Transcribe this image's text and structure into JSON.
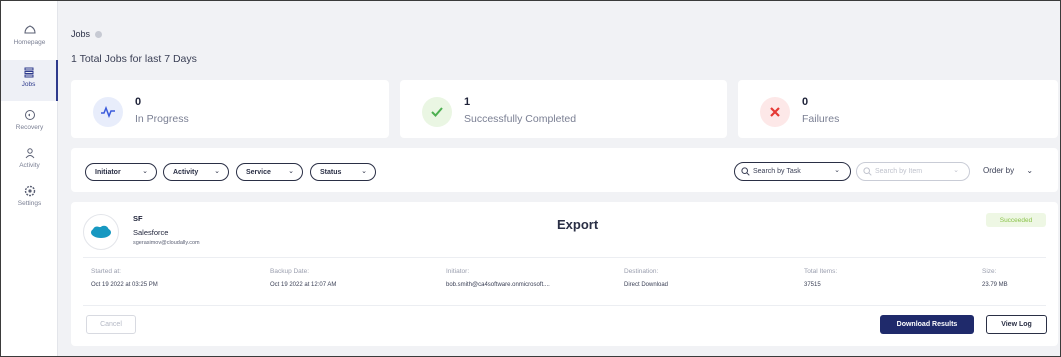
{
  "sidebar": {
    "items": [
      {
        "label": "Homepage",
        "icon": "home-icon"
      },
      {
        "label": "Jobs",
        "icon": "jobs-icon"
      },
      {
        "label": "Recovery",
        "icon": "recovery-icon"
      },
      {
        "label": "Activity",
        "icon": "activity-icon"
      },
      {
        "label": "Settings",
        "icon": "settings-icon"
      }
    ],
    "active": "Jobs"
  },
  "header": {
    "title": "Jobs",
    "subtitle": "1 Total Jobs for last 7 Days"
  },
  "stats": [
    {
      "value": "0",
      "label": "In Progress",
      "icon": "activity-pulse-icon",
      "color": "#3b5bdb"
    },
    {
      "value": "1",
      "label": "Successfully Completed",
      "icon": "check-icon",
      "color": "#4caf50"
    },
    {
      "value": "0",
      "label": "Failures",
      "icon": "x-icon",
      "color": "#e53935"
    }
  ],
  "filters": {
    "pills": [
      "Initiator",
      "Activity",
      "Service",
      "Status"
    ],
    "search_task_placeholder": "Search by Task",
    "search_item_placeholder": "Search by Item",
    "order_by": "Order by"
  },
  "job": {
    "source_short": "SF",
    "service": "Salesforce",
    "email": "sgerasimov@cloudally.com",
    "type": "Export",
    "status": "Succeeded",
    "meta": [
      {
        "label": "Started at:",
        "value": "Oct 19 2022 at 03:25 PM"
      },
      {
        "label": "Backup Date:",
        "value": "Oct 19 2022 at 12:07 AM"
      },
      {
        "label": "Initiator:",
        "value": "bob.smith@ca4software.onmicrosoft...."
      },
      {
        "label": "Destination:",
        "value": "Direct Download"
      },
      {
        "label": "Total Items:",
        "value": "37515"
      },
      {
        "label": "Size:",
        "value": "23.79 MB"
      }
    ],
    "cancel_label": "Cancel",
    "download_label": "Download Results",
    "view_log_label": "View Log"
  },
  "colors": {
    "brand": "#1f2a6b",
    "salesforce": "#1798c1",
    "success_text": "#8bc34a",
    "success_bg": "#eef7e4"
  }
}
